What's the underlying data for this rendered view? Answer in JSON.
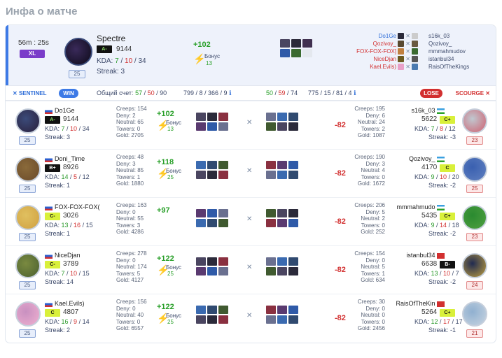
{
  "title": "Инфа о матче",
  "header": {
    "duration": "56m : 25s",
    "xl": "XL",
    "mvp": {
      "name": "Spectre",
      "rank": "A-",
      "rating": "9144",
      "kda": {
        "label": "KDA:",
        "k": "7",
        "d": "10",
        "a": "34"
      },
      "streak": "Streak: 3",
      "level": "25",
      "plus": "+102",
      "bonus_label": "Бонус",
      "bonus_value": "13"
    },
    "mvp_list": {
      "left": [
        "Do1Ge",
        "Qozivoy_",
        "FOX-FOX-FOX]",
        "NiceDjan",
        "Kael.Evils)"
      ],
      "right": [
        "s16k_03",
        "Qozivoy_",
        "mmmahmudov",
        "istanbul34",
        "RaisOfTheKings"
      ]
    }
  },
  "bar": {
    "sentinel": "SENTINEL",
    "win": "WIN",
    "score_label": "Общий счет:",
    "score": {
      "a": "57",
      "b": "50",
      "c": "90"
    },
    "stats1": "799 / 8 / 366 / 9",
    "score2": {
      "a": "50",
      "b": "59",
      "c": "74"
    },
    "stats2": "775 / 15 / 81 / 4",
    "lose": "LOSE",
    "scourge": "SCOURGE"
  },
  "rows": [
    {
      "left": {
        "name": "Do1Ge",
        "rank": "A-",
        "rating": "9144",
        "kda": {
          "k": "7",
          "d": "10",
          "a": "34"
        },
        "streak": "Streak: 3",
        "level": "25",
        "stats": [
          "Creeps: 154",
          "Deny: 2",
          "Neutral: 65",
          "Towers: 0",
          "Gold: 2705"
        ],
        "plus": "+102",
        "bonus_label": "Бонус",
        "bonus_value": "13"
      },
      "right": {
        "name": "s16k_03",
        "rank": "C+",
        "rating": "5622",
        "kda": {
          "k": "7",
          "d": "8",
          "a": "12"
        },
        "streak": "Streak: -3",
        "level": "23",
        "stats": [
          "Creeps: 195",
          "Deny: 6",
          "Neutral: 24",
          "Towers: 2",
          "Gold: 1087"
        ],
        "minus": "-82"
      }
    },
    {
      "left": {
        "name": "Doni_Time",
        "rank": "B+",
        "rating": "8926",
        "kda": {
          "k": "14",
          "d": "5",
          "a": "12"
        },
        "streak": "Streak: 1",
        "level": "25",
        "stats": [
          "Creeps: 48",
          "Deny: 3",
          "Neutral: 85",
          "Towers: 1",
          "Gold: 1880"
        ],
        "plus": "+118",
        "bonus_label": "Бонус",
        "bonus_value": "25"
      },
      "right": {
        "name": "Qozivoy_",
        "rank": "C",
        "rating": "4170",
        "kda": {
          "k": "9",
          "d": "10",
          "a": "20"
        },
        "streak": "Streak: -2",
        "level": "25",
        "stats": [
          "Creeps: 190",
          "Deny: 3",
          "Neutral: 4",
          "Towers: 0",
          "Gold: 1672"
        ],
        "minus": "-82"
      }
    },
    {
      "left": {
        "name": "FOX-FOX-FOX(",
        "rank": "C-",
        "rating": "3026",
        "kda": {
          "k": "13",
          "d": "16",
          "a": "15"
        },
        "streak": "Streak: 1",
        "level": "25",
        "stats": [
          "Creeps: 163",
          "Deny: 0",
          "Neutral: 55",
          "Towers: 3",
          "Gold: 4286"
        ],
        "plus": "+97",
        "bonus_label": "",
        "bonus_value": ""
      },
      "right": {
        "name": "mmmahmudo",
        "rank": "C+",
        "rating": "5435",
        "kda": {
          "k": "9",
          "d": "14",
          "a": "18"
        },
        "streak": "Streak: -2",
        "level": "23",
        "stats": [
          "Creeps: 206",
          "Deny: 5",
          "Neutral: 2",
          "Towers: 0",
          "Gold: 252"
        ],
        "minus": "-82"
      }
    },
    {
      "left": {
        "name": "NiceDjan",
        "rank": "C-",
        "rating": "3789",
        "kda": {
          "k": "7",
          "d": "10",
          "a": "15"
        },
        "streak": "Streak: 14",
        "level": "25",
        "stats": [
          "Creeps: 278",
          "Deny: 0",
          "Neutral: 174",
          "Towers: 5",
          "Gold: 4127"
        ],
        "plus": "+122",
        "bonus_label": "Бонус",
        "bonus_value": "25"
      },
      "right": {
        "name": "istanbul34",
        "rank": "B-",
        "rating": "6638",
        "kda": {
          "k": "13",
          "d": "10",
          "a": "7"
        },
        "streak": "Streak: -2",
        "level": "24",
        "stats": [
          "Creeps: 154",
          "Deny: 0",
          "Neutral: 5",
          "Towers: 1",
          "Gold: 634"
        ],
        "minus": "-82"
      }
    },
    {
      "left": {
        "name": "Kael.Evils)",
        "rank": "C",
        "rating": "4807",
        "kda": {
          "k": "16",
          "d": "9",
          "a": "14"
        },
        "streak": "Streak: 2",
        "level": "25",
        "stats": [
          "Creeps: 156",
          "Deny: 0",
          "Neutral: 40",
          "Towers: 0",
          "Gold: 6557"
        ],
        "plus": "+122",
        "bonus_label": "Бонус",
        "bonus_value": "25"
      },
      "right": {
        "name": "RaisOfTheKin",
        "rank": "C+",
        "rating": "5264",
        "kda": {
          "k": "12",
          "d": "17",
          "a": "17"
        },
        "streak": "Streak: -1",
        "level": "21",
        "stats": [
          "Creeps: 30",
          "Deny: 0",
          "Neutral: 0",
          "Towers: 0",
          "Gold: 2456"
        ],
        "minus": "-82"
      }
    }
  ],
  "colors": {
    "win": "#3d7ae6",
    "lose": "#d23030",
    "positive": "#2aa02a",
    "negative": "#d23030"
  }
}
